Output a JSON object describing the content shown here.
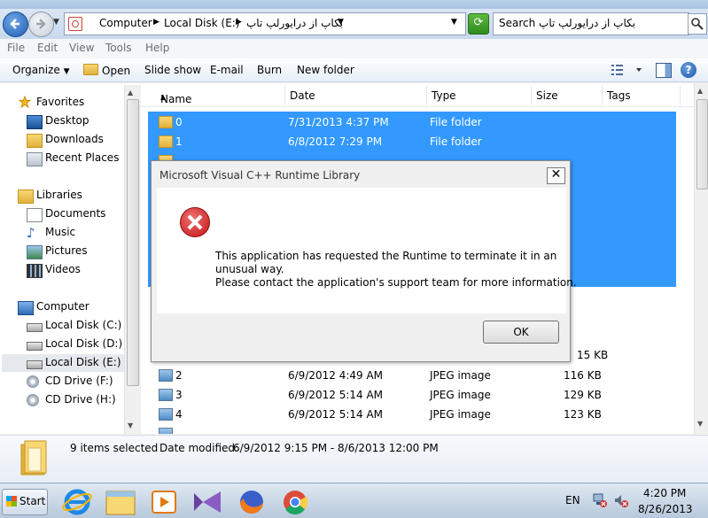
{
  "window": {
    "title_partial": "بکاپ از درایورلپ تاپ"
  },
  "address": {
    "segments": [
      "Computer",
      "Local Disk (E:)",
      "بکاپ از درایورلپ تاپ"
    ],
    "search_placeholder": "Search بکاپ از درایورلپ تاپ"
  },
  "menu": {
    "file": "File",
    "edit": "Edit",
    "view": "View",
    "tools": "Tools",
    "help": "Help"
  },
  "commands": {
    "organize": "Organize",
    "open": "Open",
    "slideshow": "Slide show",
    "email": "E-mail",
    "burn": "Burn",
    "newfolder": "New folder"
  },
  "nav": {
    "favorites": "Favorites",
    "desktop": "Desktop",
    "downloads": "Downloads",
    "recent": "Recent Places",
    "libraries": "Libraries",
    "documents": "Documents",
    "music": "Music",
    "pictures": "Pictures",
    "videos": "Videos",
    "computer": "Computer",
    "disk_c": "Local Disk (C:)",
    "disk_d": "Local Disk (D:)",
    "disk_e": "Local Disk (E:)",
    "cd_f": "CD Drive (F:)",
    "cd_h": "CD Drive (H:)"
  },
  "columns": {
    "name": "Name",
    "date": "Date",
    "type": "Type",
    "size": "Size",
    "tags": "Tags"
  },
  "rows": [
    {
      "name": "0",
      "date": "7/31/2013 4:37 PM",
      "type": "File folder",
      "size": ""
    },
    {
      "name": "1",
      "date": "6/8/2012 7:29 PM",
      "type": "File folder",
      "size": ""
    },
    {
      "name": "2",
      "date": "6/9/2012 4:49 AM",
      "type": "JPEG image",
      "size": "116 KB"
    },
    {
      "name": "3",
      "date": "6/9/2012 5:14 AM",
      "type": "JPEG image",
      "size": "129 KB"
    },
    {
      "name": "4",
      "date": "6/9/2012 5:14 AM",
      "type": "JPEG image",
      "size": "123 KB"
    }
  ],
  "partial_size": "15 KB",
  "details": {
    "selected": "9 items selected",
    "modified_label": "Date modified:",
    "modified_value": "6/9/2012 9:15 PM - 8/6/2013 12:00 PM"
  },
  "dialog": {
    "title": "Microsoft Visual C++ Runtime Library",
    "line1": "This application has requested the Runtime to terminate it in an",
    "line2": "unusual way.",
    "line3": "Please contact the application's support team for more information.",
    "ok": "OK",
    "close": "✕"
  },
  "taskbar": {
    "start": "Start",
    "lang": "EN",
    "time": "4:20 PM",
    "date": "8/26/2013"
  },
  "colors": {
    "selection": "#3399ff",
    "error": "#c51414"
  }
}
